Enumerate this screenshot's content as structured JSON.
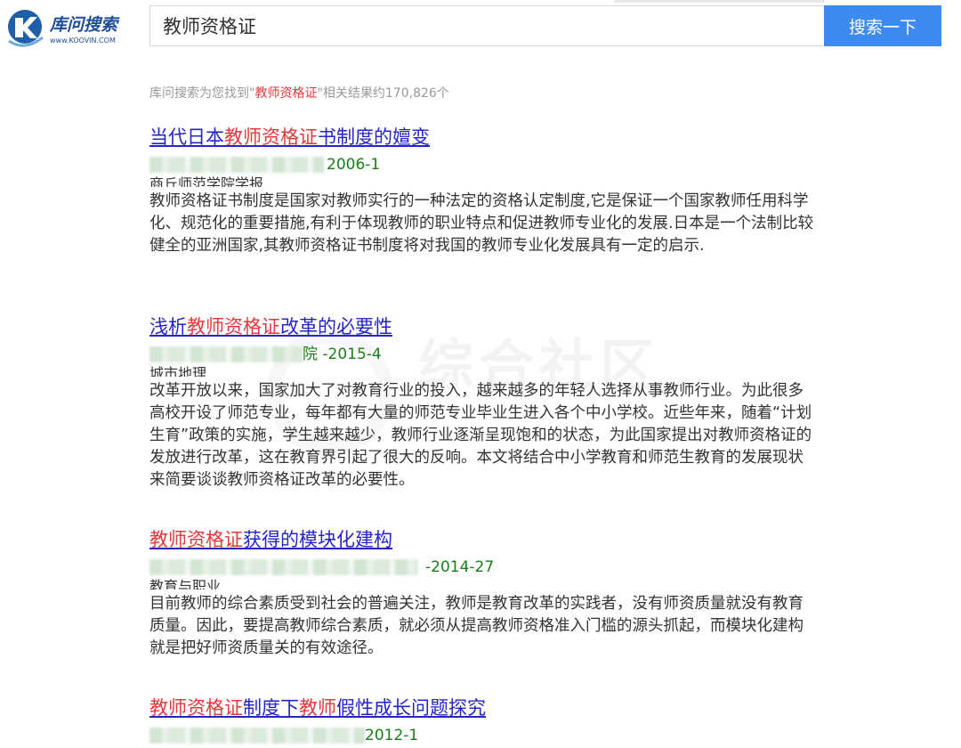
{
  "header": {
    "logo_text": "库问搜索",
    "logo_domain": "www.KOOVIN.COM",
    "search_value": "教师资格证",
    "search_button": "搜索一下",
    "brand_color": "#3d8bf0"
  },
  "summary": {
    "prefix": "库问搜索为您找到\"",
    "keyword": "教师资格证",
    "suffix": "\"相关结果约170,826个"
  },
  "watermark": "综合社区",
  "results": [
    {
      "title_pre": "当代日本",
      "title_hl": "教师资格证",
      "title_post": "书制度的嬗变",
      "meta_date": "2006-1",
      "journal": "商丘师范学院学报",
      "abstract": "教师资格证书制度是国家对教师实行的一种法定的资格认定制度,它是保证一个国家教师任用科学化、规范化的重要措施,有利于体现教师的职业特点和促进教师专业化的发展.日本是一个法制比较健全的亚洲国家,其教师资格证书制度将对我国的教师专业化发展具有一定的启示."
    },
    {
      "title_pre": "浅析",
      "title_hl": "教师资格证",
      "title_post": "改革的必要性",
      "meta_date": "院 -2015-4",
      "journal": "城市地理",
      "abstract": "改革开放以来，国家加大了对教育行业的投入，越来越多的年轻人选择从事教师行业。为此很多高校开设了师范专业，每年都有大量的师范专业毕业生进入各个中小学校。近些年来，随着“计划生育”政策的实施，学生越来越少，教师行业逐渐呈现饱和的状态，为此国家提出对教师资格证的发放进行改革，这在教育界引起了很大的反响。本文将结合中小学教育和师范生教育的发展现状来简要谈谈教师资格证改革的必要性。"
    },
    {
      "title_pre": "",
      "title_hl": "教师资格证",
      "title_post": "获得的模块化建构",
      "meta_date": "-2014-27",
      "journal": "教育与职业",
      "abstract": "目前教师的综合素质受到社会的普遍关注，教师是教育改革的实践者，没有师资质量就没有教育质量。因此，要提高教师综合素质，就必须从提高教师资格准入门槛的源头抓起，而模块化建构就是把好师资质量关的有效途径。"
    },
    {
      "title_hl": "教师资格证",
      "title_mid": "制度下",
      "title_hl2": "教师",
      "title_post": "假性成长问题探究",
      "meta_date": "2012-1"
    }
  ]
}
